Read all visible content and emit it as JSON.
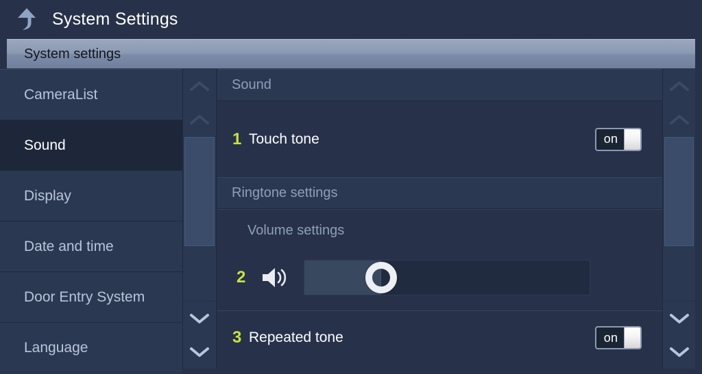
{
  "titlebar": {
    "back_icon": "back-up-arrow-icon",
    "title": "System Settings"
  },
  "breadcrumb": {
    "label": "System settings"
  },
  "sidebar": {
    "items": [
      {
        "label": "CameraList",
        "selected": false
      },
      {
        "label": "Sound",
        "selected": true
      },
      {
        "label": "Display",
        "selected": false
      },
      {
        "label": "Date and time",
        "selected": false
      },
      {
        "label": "Door Entry System",
        "selected": false
      },
      {
        "label": "Language",
        "selected": false
      }
    ]
  },
  "scrollbars": {
    "left": {
      "up_icon": "chevron-up-icon",
      "down_icon": "chevron-down-icon"
    },
    "right": {
      "up_icon": "chevron-up-icon",
      "down_icon": "chevron-down-icon"
    }
  },
  "content": {
    "sound_section": {
      "header": "Sound",
      "touch_tone": {
        "index": "1",
        "label": "Touch tone",
        "toggle_value": "on"
      }
    },
    "ringtone_section": {
      "header": "Ringtone settings",
      "volume": {
        "sub_label": "Volume settings",
        "index": "2",
        "speaker_icon": "speaker-volume-icon",
        "value_percent": 27
      },
      "repeated_tone": {
        "index": "3",
        "label": "Repeated tone",
        "toggle_value": "on"
      }
    }
  },
  "colors": {
    "app_background": "#27324a",
    "panel": "#2b3852",
    "selected_item": "#1d2739",
    "accent_index": "#c9e437",
    "muted_text": "#8f9fba",
    "primary_text": "#ffffff",
    "breadcrumb_text": "#10141f"
  }
}
